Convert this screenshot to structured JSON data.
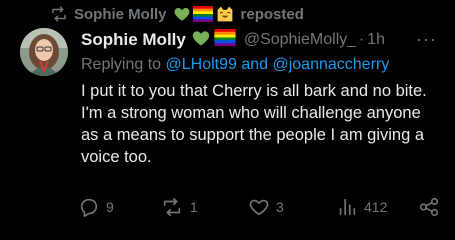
{
  "repost": {
    "user": "Sophie Molly",
    "label": "reposted"
  },
  "tweet": {
    "display_name": "Sophie Molly",
    "handle": "@SophieMolly_",
    "separator": "·",
    "time": "1h",
    "more": "···",
    "replying_prefix": "Replying to",
    "replying_users": "@LHolt99 and @joannaccherry",
    "text": "I put it to you that Cherry is all bark and no bite. I'm a strong woman who will challenge anyone as a means to support the people I am giving a voice too."
  },
  "actions": {
    "replies": "9",
    "reposts": "1",
    "likes": "3",
    "views": "412"
  },
  "colors": {
    "background": "#000000",
    "text": "#e7e9ea",
    "muted": "#71767b",
    "link": "#1d9bf0",
    "heart_emoji": "#78b159"
  },
  "icons": {
    "repost_header": "repost-icon",
    "emojis": [
      "green-heart-emoji",
      "rainbow-flag-emoji",
      "smiling-cat-emoji"
    ],
    "reply": "reply-icon",
    "repost": "repost-icon",
    "like": "heart-icon",
    "views": "bar-chart-icon",
    "share": "share-icon"
  }
}
